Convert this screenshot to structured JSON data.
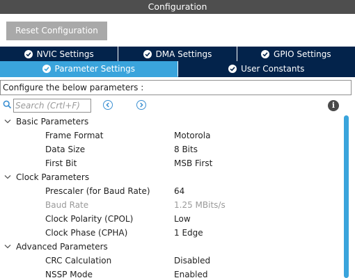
{
  "window": {
    "title": "Configuration"
  },
  "toolbar": {
    "reset_label": "Reset Configuration"
  },
  "tabs": {
    "row1": [
      {
        "label": "NVIC Settings",
        "active": false
      },
      {
        "label": "DMA Settings",
        "active": false
      },
      {
        "label": "GPIO Settings",
        "active": false
      }
    ],
    "row2": [
      {
        "label": "Parameter Settings",
        "active": true
      },
      {
        "label": "User Constants",
        "active": false
      }
    ]
  },
  "config": {
    "label": "Configure the below parameters :"
  },
  "search": {
    "placeholder": "Search (Crtl+F)",
    "value": ""
  },
  "groups": [
    {
      "label": "Basic Parameters",
      "params": [
        {
          "name": "Frame Format",
          "value": "Motorola",
          "enabled": true
        },
        {
          "name": "Data Size",
          "value": "8 Bits",
          "enabled": true
        },
        {
          "name": "First Bit",
          "value": "MSB First",
          "enabled": true
        }
      ]
    },
    {
      "label": "Clock Parameters",
      "params": [
        {
          "name": "Prescaler (for Baud Rate)",
          "value": "64",
          "enabled": true
        },
        {
          "name": "Baud Rate",
          "value": "1.25 MBits/s",
          "enabled": false
        },
        {
          "name": "Clock Polarity (CPOL)",
          "value": "Low",
          "enabled": true
        },
        {
          "name": "Clock Phase (CPHA)",
          "value": "1 Edge",
          "enabled": true
        }
      ]
    },
    {
      "label": "Advanced Parameters",
      "params": [
        {
          "name": "CRC Calculation",
          "value": "Disabled",
          "enabled": true
        },
        {
          "name": "NSSP Mode",
          "value": "Enabled",
          "enabled": true
        }
      ]
    }
  ],
  "colors": {
    "tab_bg": "#03234b",
    "tab_active": "#3aa4dc",
    "titlebar": "#4e4e4e",
    "accent": "#3a8fd2"
  }
}
